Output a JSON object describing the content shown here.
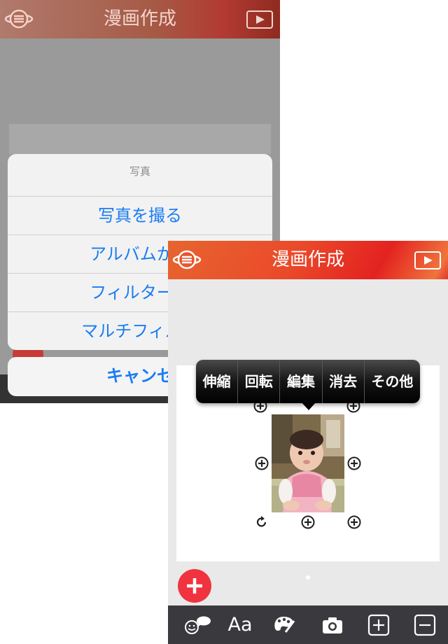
{
  "back_screen": {
    "header": {
      "title": "漫画作成"
    },
    "action_sheet": {
      "title": "写真",
      "options": [
        "写真を撮る",
        "アルバムから",
        "フィルター付",
        "マルチフィルタ"
      ],
      "cancel_label": "キャンセ"
    }
  },
  "front_screen": {
    "header": {
      "title": "漫画作成"
    },
    "context_menu": {
      "items": [
        "伸縮",
        "回転",
        "編集",
        "消去",
        "その他"
      ]
    },
    "toolbar": {
      "icons": [
        "sticker-speech-icon",
        "text-icon",
        "palette-icon",
        "camera-icon",
        "add-panel-icon",
        "remove-panel-icon"
      ],
      "text_label": "Aa"
    }
  },
  "colors": {
    "header_red": "#e32220",
    "add_button_red": "#f0333f",
    "ios_blue": "#1a7cf2",
    "toolbar_dark": "#3a3a3e"
  }
}
